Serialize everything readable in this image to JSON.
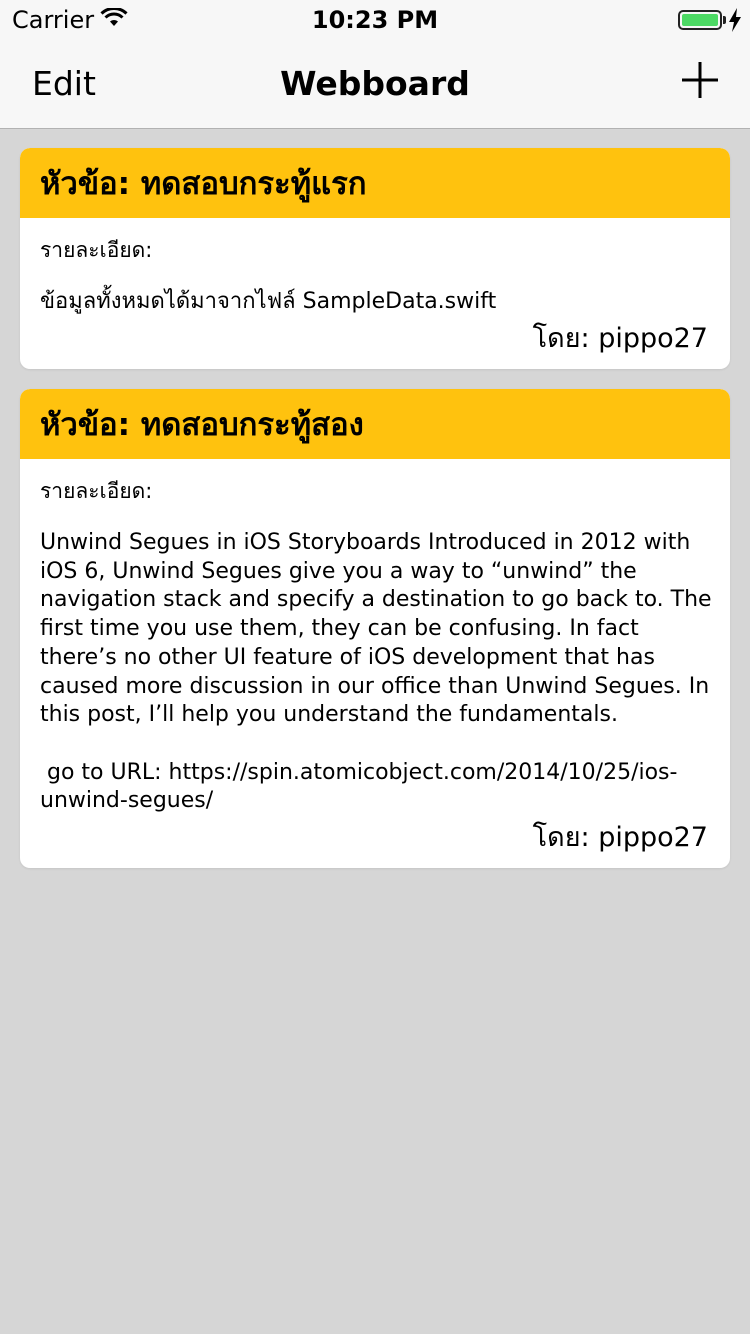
{
  "status_bar": {
    "carrier": "Carrier",
    "time": "10:23 PM"
  },
  "nav": {
    "edit_label": "Edit",
    "title": "Webboard"
  },
  "posts": [
    {
      "title": "หัวข้อ: ทดสอบกระทู้แรก",
      "detail_label": "รายละเอียด:",
      "body": "ข้อมูลทั้งหมดได้มาจากไฟล์ SampleData.swift",
      "author": "โดย: pippo27"
    },
    {
      "title": "หัวข้อ: ทดสอบกระทู้สอง",
      "detail_label": "รายละเอียด:",
      "body": "Unwind Segues in iOS Storyboards Introduced in 2012 with iOS 6, Unwind Segues give you a way to “unwind” the navigation stack and specify a destination to go back to. The first time you use them, they can be confusing. In fact there’s no other UI feature of iOS development that has caused more discussion in our office than Unwind Segues. In this post, I’ll help you understand the fundamentals.\n\n go to URL: https://spin.atomicobject.com/2014/10/25/ios-unwind-segues/",
      "author": "โดย: pippo27"
    }
  ],
  "colors": {
    "header": "#ffc20e",
    "background": "#d6d6d6",
    "battery": "#4cd964"
  }
}
